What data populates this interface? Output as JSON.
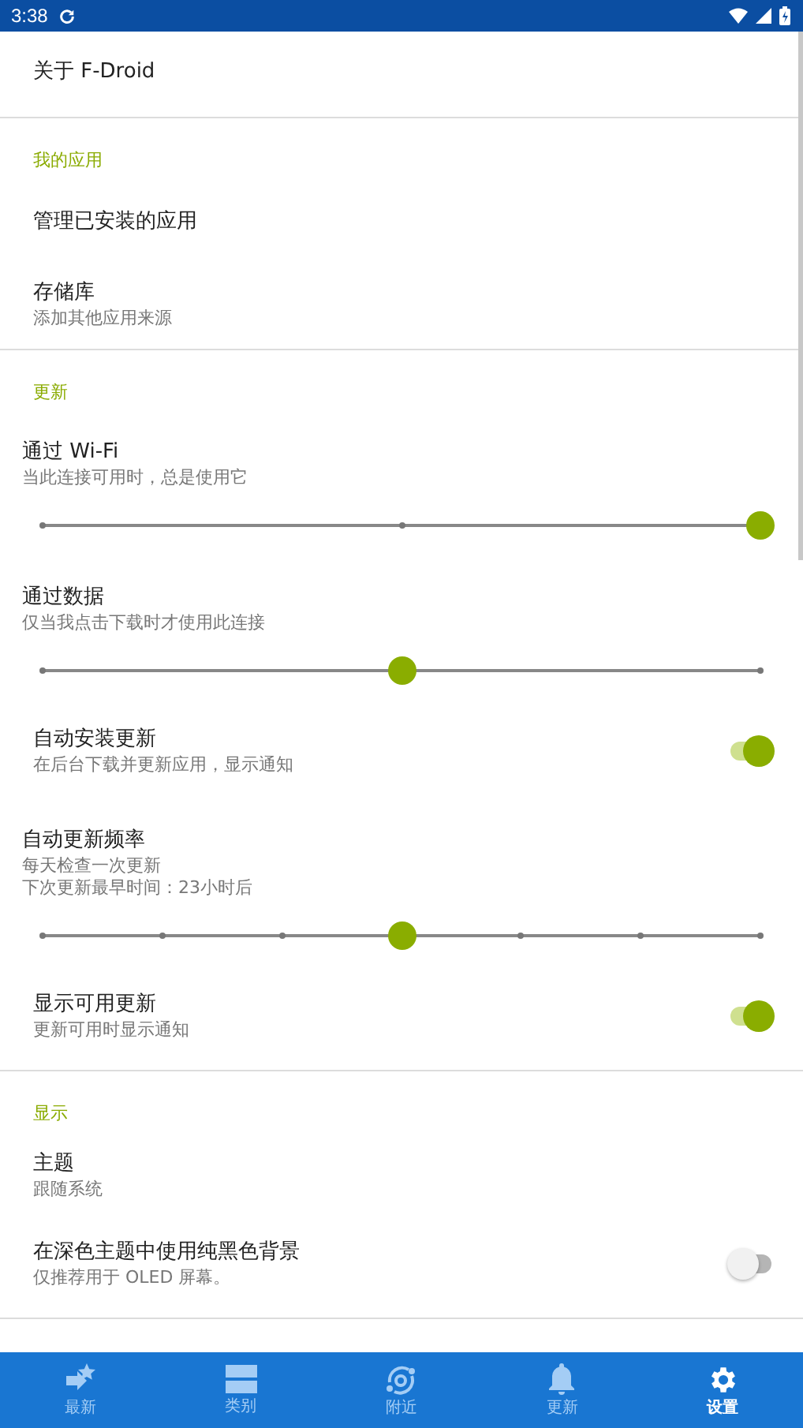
{
  "status_bar": {
    "time": "3:38"
  },
  "sections": [
    {
      "items": [
        {
          "kind": "item",
          "title": "关于 F-Droid"
        }
      ]
    },
    {
      "header": "我的应用",
      "items": [
        {
          "kind": "item",
          "title": "管理已安装的应用"
        },
        {
          "kind": "item",
          "title": "存储库",
          "summary": [
            "添加其他应用来源"
          ]
        }
      ]
    },
    {
      "header": "更新",
      "items": [
        {
          "kind": "slider",
          "title": "通过 Wi-Fi",
          "summary": [
            "当此连接可用时，总是使用它"
          ],
          "level": 1
        },
        {
          "kind": "slider",
          "title": "通过数据",
          "summary": [
            "仅当我点击下载时才使用此连接"
          ],
          "level": 0.5
        },
        {
          "kind": "switch",
          "title": "自动安装更新",
          "summary": [
            "在后台下载并更新应用，显示通知"
          ],
          "on": true
        },
        {
          "kind": "scale",
          "title": "自动更新频率",
          "summary": [
            "每天检查一次更新",
            "下次更新最早时间：23小时后"
          ],
          "level": 0.5
        },
        {
          "kind": "switch",
          "title": "显示可用更新",
          "summary": [
            "更新可用时显示通知"
          ],
          "on": true
        }
      ]
    },
    {
      "header": "显示",
      "items": [
        {
          "kind": "item",
          "title": "主题",
          "summary": [
            "跟随系统"
          ]
        },
        {
          "kind": "switch",
          "title": "在深色主题中使用纯黑色背景",
          "summary": [
            "仅推荐用于 OLED 屏幕。"
          ],
          "on": false
        }
      ]
    }
  ],
  "nav": [
    {
      "label": "最新",
      "selected": false
    },
    {
      "label": "类别",
      "selected": false
    },
    {
      "label": "附近",
      "selected": false
    },
    {
      "label": "更新",
      "selected": false
    },
    {
      "label": "设置",
      "selected": true
    }
  ]
}
